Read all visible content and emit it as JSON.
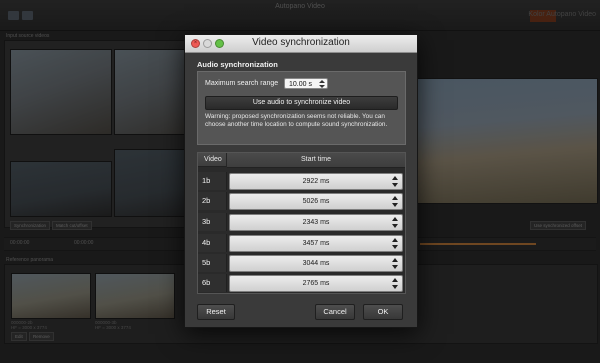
{
  "app": {
    "title": "Autopano Video",
    "logo_text": "Kolor Autopano Video",
    "input_panel_label": "Input source videos",
    "input_buttons": [
      "Synchronization",
      "Match cut/offset"
    ],
    "timecode_left": "00:00:00",
    "timecode_right": "00:00:00",
    "tc_checkbox_label": "Use synchronized offset",
    "reference_label": "Reference panorama",
    "ref_thumbs": [
      {
        "name": "000000-2b",
        "info": "HF = 3000 x 3774"
      },
      {
        "name": "000000-3b",
        "info": "HF = 3000 x 3774"
      }
    ],
    "ref_buttons": [
      "Edit",
      "Remove"
    ]
  },
  "dialog": {
    "title": "Video synchronization",
    "audio_section_title": "Audio synchronization",
    "max_range_label": "Maximum search range",
    "max_range_value": "10.00 s",
    "use_audio_button": "Use audio to synchronize video",
    "warning": "Warning: proposed synchronization seems not reliable. You can choose another time location to compute sound synchronization.",
    "table": {
      "col_video": "Video",
      "col_start": "Start time",
      "rows": [
        {
          "video": "1b",
          "start": "2922 ms"
        },
        {
          "video": "2b",
          "start": "5026 ms"
        },
        {
          "video": "3b",
          "start": "2343 ms"
        },
        {
          "video": "4b",
          "start": "3457 ms"
        },
        {
          "video": "5b",
          "start": "3044 ms"
        },
        {
          "video": "6b",
          "start": "2765 ms"
        }
      ]
    },
    "reset_button": "Reset",
    "cancel_button": "Cancel",
    "ok_button": "OK"
  }
}
